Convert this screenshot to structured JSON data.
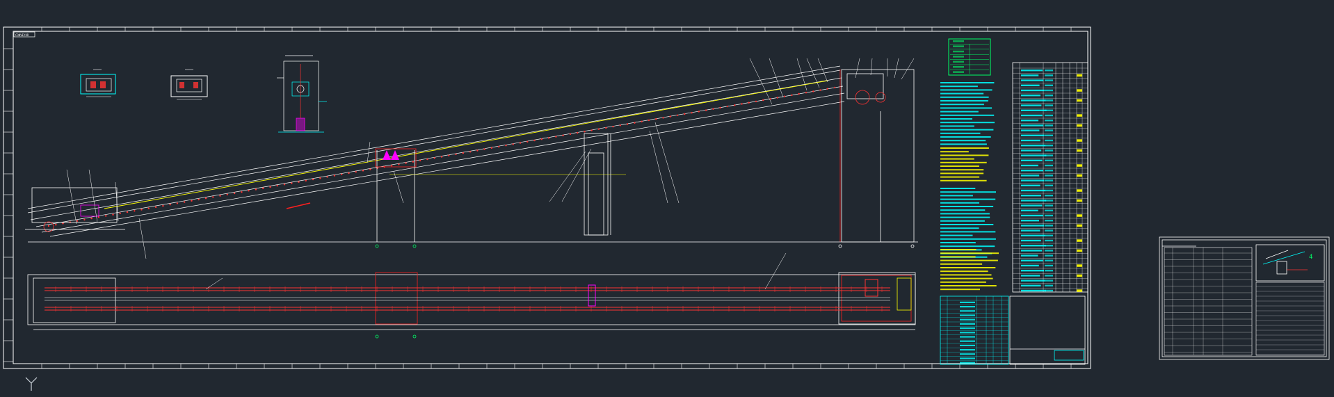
{
  "colors": {
    "background": "#212830",
    "frame": "#ffffff",
    "structure": "#ffffff",
    "belt": "#ffffff",
    "idler": "#ff3333",
    "guide": "#ffff00",
    "component": "#ff00ff",
    "table": "#00ffff",
    "notes": "#00ffff",
    "highlight": "#ffff00",
    "tech_table_border": "#00ff66",
    "section_line": "#ff2020",
    "grid_marker": "#00ff66"
  },
  "drawing": {
    "frame_label": "CONVEYOR"
  },
  "icons": {
    "ucs": "ucs-axis-icon"
  }
}
